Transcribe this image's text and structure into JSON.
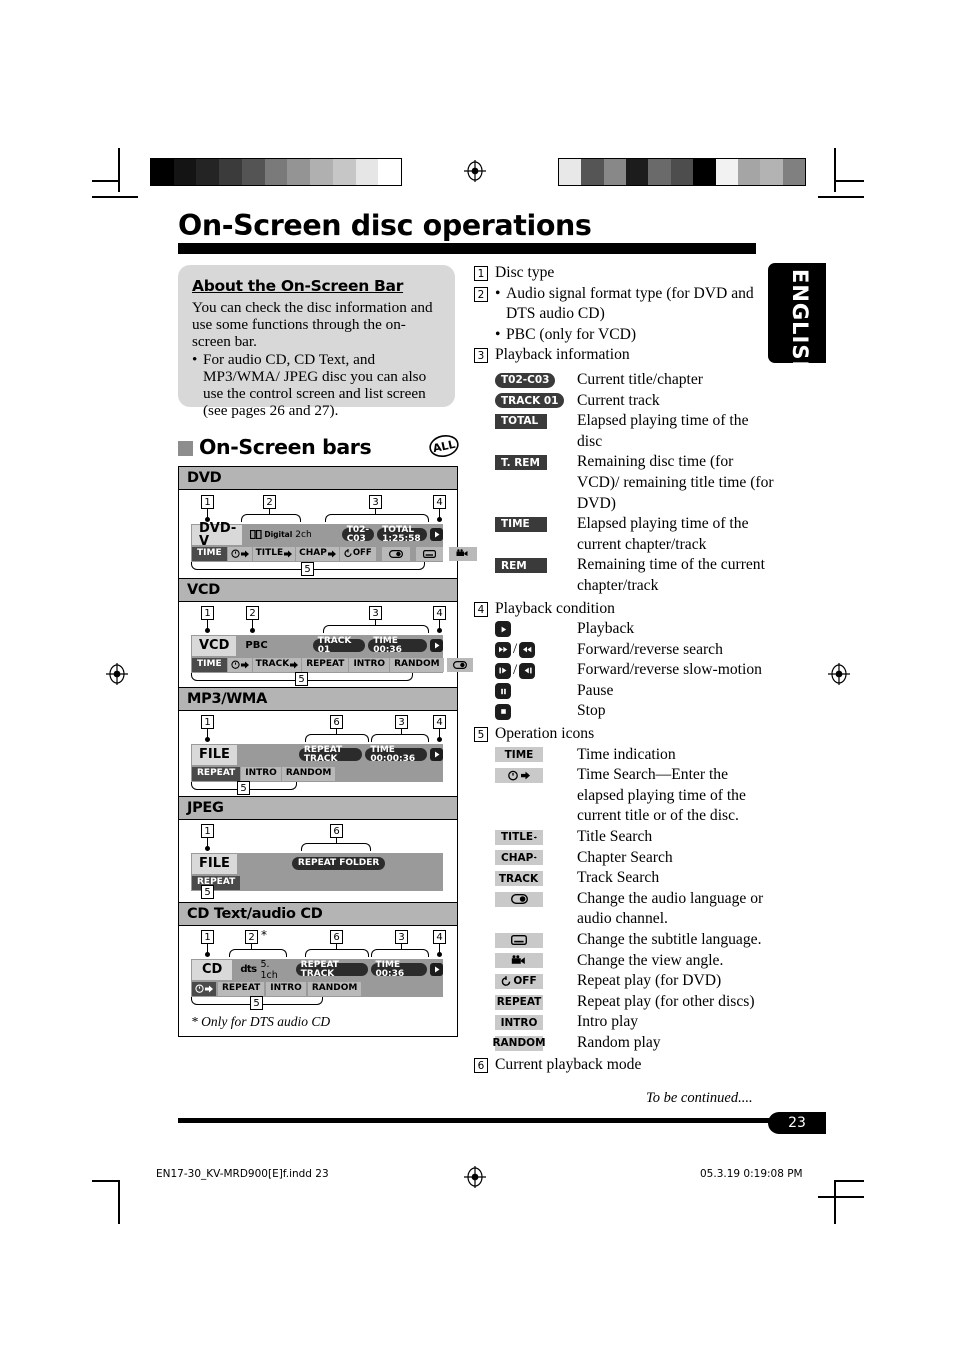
{
  "page": {
    "title": "On-Screen disc operations",
    "language_tab": "ENGLISH",
    "page_number": "23",
    "to_be_continued": "To be continued....",
    "footer_left": "EN17-30_KV-MRD900[E]f.indd   23",
    "footer_right": "05.3.19   0:19:08 PM"
  },
  "about": {
    "heading": "About the On-Screen Bar",
    "paragraph": "You can check the disc information and use some functions through the on-screen bar.",
    "bullets": [
      "For audio CD, CD Text, and MP3/WMA/ JPEG disc you can also use the control screen and list screen (see pages 26 and 27)."
    ]
  },
  "bars_section": {
    "heading": "On-Screen bars",
    "badge": "ALL",
    "footnote": "* Only for DTS audio CD",
    "sections": [
      {
        "title": "DVD",
        "disc_label": "DVD-V",
        "format_label": "Digital",
        "channels": "2ch",
        "info_chips": [
          "T02-C03",
          "TOTAL  1:25:58"
        ],
        "play_state": "play-icon",
        "op_icons": [
          "TIME",
          "time-search-icon",
          "TITLE",
          "CHAP",
          "repeat-off",
          "audio-icon",
          "subtitle-icon",
          "angle-icon"
        ],
        "callouts": [
          "1",
          "2",
          "3",
          "4",
          "5"
        ]
      },
      {
        "title": "VCD",
        "disc_label": "VCD",
        "pbc_label": "PBC",
        "info_chips": [
          "TRACK 01",
          "TIME        00:36"
        ],
        "play_state": "play-icon",
        "op_icons": [
          "TIME",
          "time-search-icon",
          "TRACK",
          "REPEAT",
          "INTRO",
          "RANDOM",
          "audio-icon"
        ],
        "callouts": [
          "1",
          "2",
          "3",
          "4",
          "5"
        ]
      },
      {
        "title": "MP3/WMA",
        "disc_label": "FILE",
        "mode_chip": "REPEAT TRACK",
        "info_chips": [
          "TIME   00:00:36"
        ],
        "play_state": "play-icon",
        "op_icons": [
          "REPEAT",
          "INTRO",
          "RANDOM"
        ],
        "callouts": [
          "1",
          "6",
          "3",
          "4",
          "5"
        ]
      },
      {
        "title": "JPEG",
        "disc_label": "FILE",
        "mode_chip": "REPEAT FOLDER",
        "op_icons": [
          "REPEAT"
        ],
        "callouts": [
          "1",
          "6",
          "5"
        ]
      },
      {
        "title": "CD Text/audio CD",
        "disc_label": "CD",
        "format_label": "dts",
        "channels": "5. 1ch",
        "mode_chip": "REPEAT TRACK",
        "info_chips": [
          "TIME        00:36"
        ],
        "play_state": "play-icon",
        "op_icons": [
          "time-search-icon",
          "REPEAT",
          "INTRO",
          "RANDOM"
        ],
        "callouts": [
          "1",
          "2",
          "6",
          "3",
          "4",
          "5"
        ],
        "asterisk": "*"
      }
    ]
  },
  "legend": {
    "items": [
      {
        "num": "1",
        "text": "Disc type"
      },
      {
        "num": "2",
        "bullets": [
          "Audio signal format type (for DVD and DTS audio CD)",
          "PBC (only for VCD)"
        ]
      },
      {
        "num": "3",
        "text": "Playback information",
        "rows": [
          {
            "chip": "T02-C03",
            "style": "round",
            "desc": "Current title/chapter"
          },
          {
            "chip": "TRACK 01",
            "style": "round",
            "desc": "Current track"
          },
          {
            "chip": "TOTAL",
            "style": "box",
            "desc": "Elapsed playing time of the disc"
          },
          {
            "chip": "T. REM",
            "style": "box",
            "desc": "Remaining disc time (for VCD)/ remaining title time (for DVD)"
          },
          {
            "chip": "TIME",
            "style": "box",
            "desc": "Elapsed playing time of the current chapter/track"
          },
          {
            "chip": "REM",
            "style": "box",
            "desc": "Remaining time of the current chapter/track"
          }
        ]
      },
      {
        "num": "4",
        "text": "Playback condition",
        "rows": [
          {
            "icon": "play-icon",
            "desc": "Playback"
          },
          {
            "icon": "ffwd-rew-icons",
            "desc": "Forward/reverse search"
          },
          {
            "icon": "slow-fwd-rev-icons",
            "desc": "Forward/reverse slow-motion"
          },
          {
            "icon": "pause-icon",
            "desc": "Pause"
          },
          {
            "icon": "stop-icon",
            "desc": "Stop"
          }
        ]
      },
      {
        "num": "5",
        "text": "Operation icons",
        "rows": [
          {
            "chip": "TIME",
            "style": "gray",
            "desc": "Time indication"
          },
          {
            "icon": "time-search-icon",
            "desc": "Time Search—Enter the elapsed playing time of the current title or of the disc."
          },
          {
            "chip": "TITLE",
            "style": "gray-arrow",
            "desc": "Title Search"
          },
          {
            "chip": "CHAP",
            "style": "gray-arrow",
            "desc": "Chapter Search"
          },
          {
            "chip": "TRACK",
            "style": "gray-arrow",
            "desc": "Track Search"
          },
          {
            "icon": "audio-icon",
            "desc": "Change the audio language or audio channel."
          },
          {
            "icon": "subtitle-icon",
            "desc": "Change the subtitle language."
          },
          {
            "icon": "angle-icon",
            "desc": "Change the view angle."
          },
          {
            "chip": "OFF",
            "style": "gray-repeat",
            "desc": "Repeat play (for DVD)"
          },
          {
            "chip": "REPEAT",
            "style": "gray",
            "desc": "Repeat play (for other discs)"
          },
          {
            "chip": "INTRO",
            "style": "gray",
            "desc": "Intro play"
          },
          {
            "chip": "RANDOM",
            "style": "gray",
            "desc": "Random play"
          }
        ]
      },
      {
        "num": "6",
        "text": "Current playback mode"
      }
    ]
  }
}
